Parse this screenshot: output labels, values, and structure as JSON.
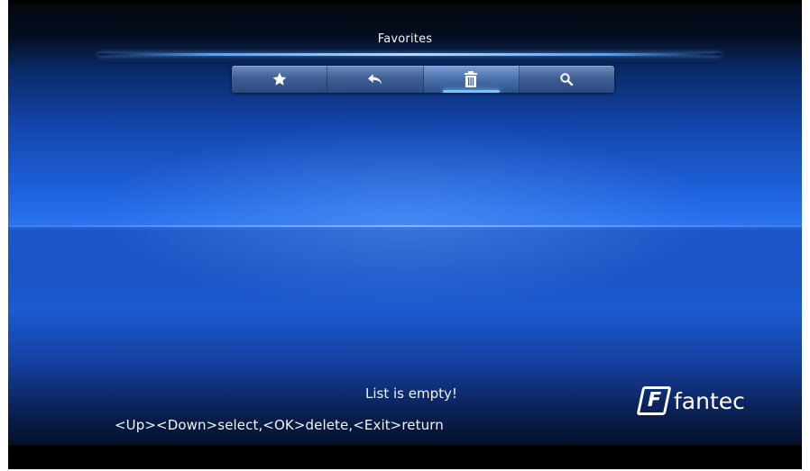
{
  "header": {
    "title": "Favorites"
  },
  "toolbar": {
    "items": [
      {
        "icon": "star-icon",
        "label": "Favorites"
      },
      {
        "icon": "back-arrow-icon",
        "label": "Return"
      },
      {
        "icon": "trash-icon",
        "label": "Delete",
        "active": true
      },
      {
        "icon": "search-icon",
        "label": "Search"
      }
    ]
  },
  "main": {
    "empty_message": "List is empty!",
    "help_text": "<Up><Down>select,<OK>delete,<Exit>return"
  },
  "brand": {
    "logo_mark": "F",
    "logo_text": "fantec"
  },
  "colors": {
    "background_blue": "#2a72f0",
    "text": "#eef4ff",
    "accent": "#7cc4ff"
  }
}
